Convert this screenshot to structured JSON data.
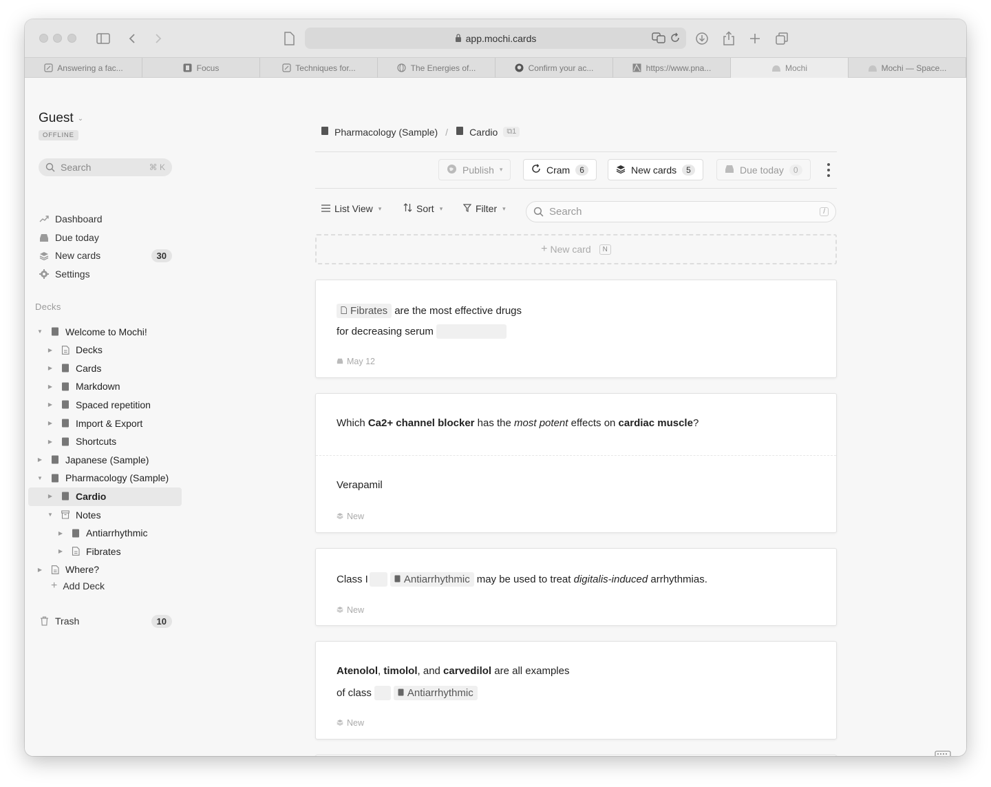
{
  "browser": {
    "url": "app.mochi.cards",
    "tabs": [
      {
        "label": "Answering a fac...",
        "icon": "edit-icon"
      },
      {
        "label": "Focus",
        "icon": "app-icon"
      },
      {
        "label": "Techniques for...",
        "icon": "edit-icon"
      },
      {
        "label": "The Energies of...",
        "icon": "globe-icon"
      },
      {
        "label": "Confirm your ac...",
        "icon": "github-icon"
      },
      {
        "label": "https://www.pna...",
        "icon": "site-icon"
      },
      {
        "label": "Mochi",
        "icon": "mochi-icon"
      },
      {
        "label": "Mochi — Space...",
        "icon": "mochi-icon"
      }
    ],
    "active_tab": 6
  },
  "sidebar": {
    "user": "Guest",
    "status": "OFFLINE",
    "search_label": "Search",
    "search_shortcut": "⌘ K",
    "nav": [
      {
        "label": "Dashboard",
        "icon": "trend-icon",
        "count": ""
      },
      {
        "label": "Due today",
        "icon": "inbox-icon",
        "count": ""
      },
      {
        "label": "New cards",
        "icon": "stack-icon",
        "count": "30"
      },
      {
        "label": "Settings",
        "icon": "gear-icon",
        "count": ""
      }
    ],
    "decks_label": "Decks",
    "tree": [
      {
        "label": "Welcome to Mochi!",
        "depth": 0,
        "arrow": "down",
        "icon": "deck"
      },
      {
        "label": "Decks",
        "depth": 1,
        "arrow": "right",
        "icon": "doc"
      },
      {
        "label": "Cards",
        "depth": 1,
        "arrow": "right",
        "icon": "deck"
      },
      {
        "label": "Markdown",
        "depth": 1,
        "arrow": "right",
        "icon": "deck"
      },
      {
        "label": "Spaced repetition",
        "depth": 1,
        "arrow": "right",
        "icon": "deck"
      },
      {
        "label": "Import & Export",
        "depth": 1,
        "arrow": "right",
        "icon": "deck"
      },
      {
        "label": "Shortcuts",
        "depth": 1,
        "arrow": "right",
        "icon": "deck"
      },
      {
        "label": "Japanese (Sample)",
        "depth": 0,
        "arrow": "right",
        "icon": "deck"
      },
      {
        "label": "Pharmacology (Sample)",
        "depth": 0,
        "arrow": "down",
        "icon": "deck"
      },
      {
        "label": "Cardio",
        "depth": 1,
        "arrow": "right",
        "icon": "deck",
        "selected": true
      },
      {
        "label": "Notes",
        "depth": 1,
        "arrow": "down",
        "icon": "archive"
      },
      {
        "label": "Antiarrhythmic",
        "depth": 2,
        "arrow": "right",
        "icon": "deck"
      },
      {
        "label": "Fibrates",
        "depth": 2,
        "arrow": "right",
        "icon": "doc"
      },
      {
        "label": "Where?",
        "depth": 0,
        "arrow": "right",
        "icon": "doc"
      }
    ],
    "add_deck": "Add Deck",
    "trash_label": "Trash",
    "trash_count": "10"
  },
  "main": {
    "breadcrumb": {
      "parent": "Pharmacology (Sample)",
      "separator": "/",
      "current": "Cardio",
      "badge": "1"
    },
    "actions": {
      "publish": "Publish",
      "cram": "Cram",
      "cram_count": "6",
      "new_cards": "New cards",
      "new_cards_count": "5",
      "due_today": "Due today",
      "due_today_count": "0"
    },
    "toolbar": {
      "view": "List View",
      "sort": "Sort",
      "filter": "Filter",
      "search_placeholder": "Search",
      "search_shortcut": "/"
    },
    "new_card": {
      "label": "New card",
      "shortcut": "N"
    },
    "cards": [
      {
        "tag": "Fibrates",
        "text1": "are the most effective drugs",
        "text2": "for decreasing serum",
        "meta": "May 12"
      },
      {
        "q_pre": "Which ",
        "q_b1": "Ca2+ channel blocker",
        "q_mid1": " has the ",
        "q_i1": "most potent",
        "q_mid2": " effects on ",
        "q_b2": "cardiac muscle",
        "q_post": "?",
        "answer": "Verapamil",
        "meta": "New"
      },
      {
        "pre": "Class I",
        "tag": "Antiarrhythmic",
        "mid": "may be used to treat ",
        "ital": "digitalis-induced",
        "post": " arrhythmias.",
        "meta": "New"
      },
      {
        "b1": "Atenolol",
        "c1": ", ",
        "b2": "timolol",
        "c2": ", and ",
        "b3": "carvedilol",
        "rest": " are all examples",
        "line2": "of class",
        "tag": "Antiarrhythmic",
        "meta": "New"
      }
    ]
  }
}
